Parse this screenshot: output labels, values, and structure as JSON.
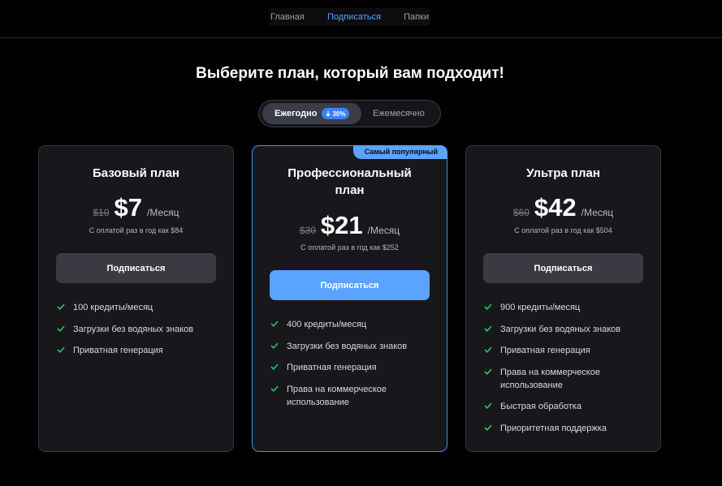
{
  "nav": {
    "items": [
      {
        "label": "Главная",
        "active": false
      },
      {
        "label": "Подписаться",
        "active": true
      },
      {
        "label": "Папки",
        "active": false
      }
    ]
  },
  "headline": "Выберите план, который вам подходит!",
  "billing_toggle": {
    "yearly_label": "Ежегодно",
    "discount_badge": "30%",
    "monthly_label": "Ежемесячно",
    "selected": "yearly"
  },
  "colors": {
    "accent": "#5aa3ff",
    "check": "#22c55e",
    "card_bg": "#18181c"
  },
  "plans": [
    {
      "name": "Базовый план",
      "old_price": "$10",
      "price": "$7",
      "period": "/Месяц",
      "billed_note": "С оплатой раз в год как $84",
      "button_label": "Подписаться",
      "features": [
        "100 кредиты/месяц",
        "Загрузки без водяных знаков",
        "Приватная генерация"
      ]
    },
    {
      "name": "Профессиональный план",
      "popular_label": "Самый популярный",
      "old_price": "$30",
      "price": "$21",
      "period": "/Месяц",
      "billed_note": "С оплатой раз в год как $252",
      "button_label": "Подписаться",
      "features": [
        "400 кредиты/месяц",
        "Загрузки без водяных знаков",
        "Приватная генерация",
        "Права на коммерческое использование"
      ]
    },
    {
      "name": "Ультра план",
      "old_price": "$60",
      "price": "$42",
      "period": "/Месяц",
      "billed_note": "С оплатой раз в год как $504",
      "button_label": "Подписаться",
      "features": [
        "900 кредиты/месяц",
        "Загрузки без водяных знаков",
        "Приватная генерация",
        "Права на коммерческое использование",
        "Быстрая обработка",
        "Приоритетная поддержка"
      ]
    }
  ]
}
